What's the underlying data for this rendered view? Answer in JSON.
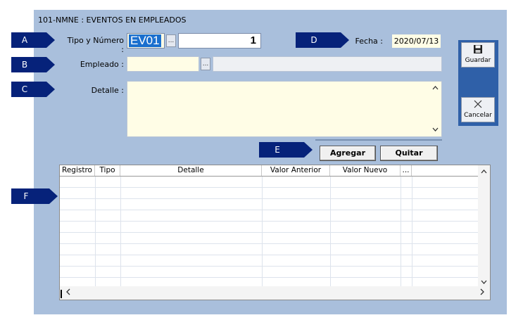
{
  "window": {
    "title": "101-NMNE : EVENTOS EN EMPLEADOS"
  },
  "badges": {
    "a": "A",
    "b": "B",
    "c": "C",
    "d": "D",
    "e": "E",
    "f": "F"
  },
  "header": {
    "tipo_label": "Tipo y Número :",
    "tipo_value": "EV01",
    "lookup_label": "...",
    "numero_value": "1",
    "fecha_label": "Fecha :",
    "fecha_value": "2020/07/13"
  },
  "empleado": {
    "label": "Empleado :",
    "code": "",
    "name": "",
    "lookup_label": "..."
  },
  "detalle": {
    "label": "Detalle :",
    "value": ""
  },
  "side_buttons": {
    "guardar": "Guardar",
    "cancelar": "Cancelar"
  },
  "actions": {
    "agregar": "Agregar",
    "quitar": "Quitar"
  },
  "grid": {
    "columns": [
      "Registro",
      "Tipo",
      "Detalle",
      "Valor Anterior",
      "Valor Nuevo",
      "..."
    ],
    "rows": []
  },
  "icons": {
    "save": "floppy-disk-icon",
    "cancel": "x-cross-icon",
    "scroll_up": "chevron-up-icon",
    "scroll_down": "chevron-down-icon",
    "scroll_left": "chevron-left-icon",
    "scroll_right": "chevron-right-icon"
  },
  "colors": {
    "window_bg": "#a9bfdc",
    "badge": "#06227a",
    "input_yellow": "#fffde6",
    "side_panel": "#2f60a8",
    "selection": "#1a6fce"
  }
}
